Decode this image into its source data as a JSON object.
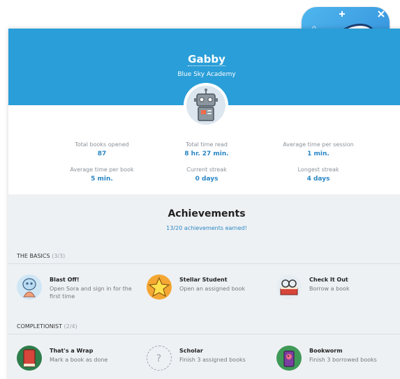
{
  "profile": {
    "name": "Gabby",
    "school": "Blue Sky Academy"
  },
  "stats": [
    {
      "label": "Total books opened",
      "value": "87"
    },
    {
      "label": "Total time read",
      "value": "8 hr. 27 min."
    },
    {
      "label": "Average time per session",
      "value": "1 min."
    },
    {
      "label": "Average time per book",
      "value": "5 min."
    },
    {
      "label": "Current streak",
      "value": "0 days"
    },
    {
      "label": "Longest streak",
      "value": "4 days"
    }
  ],
  "achievements": {
    "title": "Achievements",
    "summary": "13/20 achievements earned!",
    "sections": [
      {
        "name": "THE BASICS",
        "count": "(3/3)",
        "items": [
          {
            "name": "Blast Off!",
            "desc": "Open Sora and sign in for the first time",
            "icon": "sora-mascot-icon"
          },
          {
            "name": "Stellar Student",
            "desc": "Open an assigned book",
            "icon": "star-icon"
          },
          {
            "name": "Check It Out",
            "desc": "Borrow a book",
            "icon": "book-glasses-icon"
          }
        ]
      },
      {
        "name": "COMPLETIONIST",
        "count": "(2/4)",
        "items": [
          {
            "name": "That's a Wrap",
            "desc": "Mark a book as done",
            "icon": "red-book-icon"
          },
          {
            "name": "Scholar",
            "desc": "Finish 3 assigned books",
            "icon": "question-mark-icon"
          },
          {
            "name": "Bookworm",
            "desc": "Finish 3 borrowed books",
            "icon": "bookworm-icon"
          }
        ]
      }
    ]
  },
  "app_icon": "sora-app-icon",
  "colors": {
    "banner": "#2a9ed8",
    "accent": "#2a86c4",
    "background": "#eef1f4"
  }
}
